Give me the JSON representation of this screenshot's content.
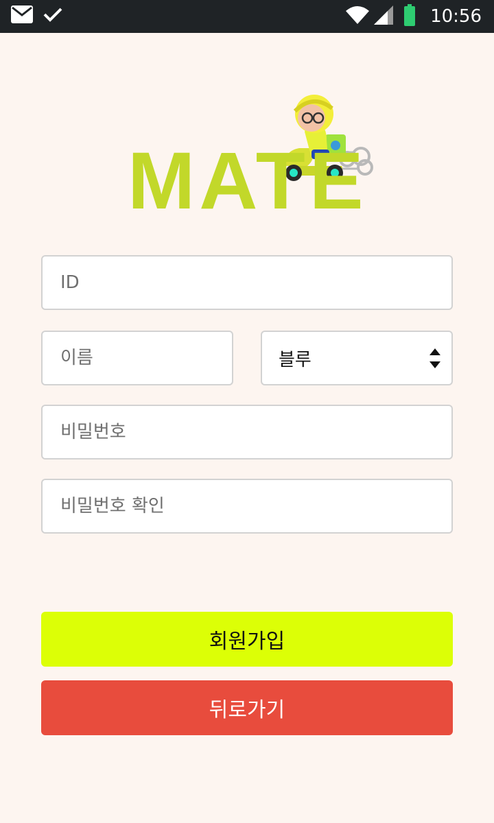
{
  "status_bar": {
    "time": "10:56",
    "icons": [
      "mail-icon",
      "check-icon",
      "wifi-icon",
      "signal-icon",
      "battery-icon"
    ]
  },
  "logo": {
    "text": "MATE",
    "color": "#c2d82a"
  },
  "form": {
    "id_placeholder": "ID",
    "name_placeholder": "이름",
    "team_select_value": "블루",
    "password_placeholder": "비밀번호",
    "password_confirm_placeholder": "비밀번호 확인"
  },
  "buttons": {
    "signup_label": "회원가입",
    "back_label": "뒤로가기"
  },
  "colors": {
    "background": "#fdf5f0",
    "signup_button": "#dcff06",
    "back_button": "#e84c3d",
    "status_bar": "#1f2326",
    "battery": "#2ecc71"
  }
}
